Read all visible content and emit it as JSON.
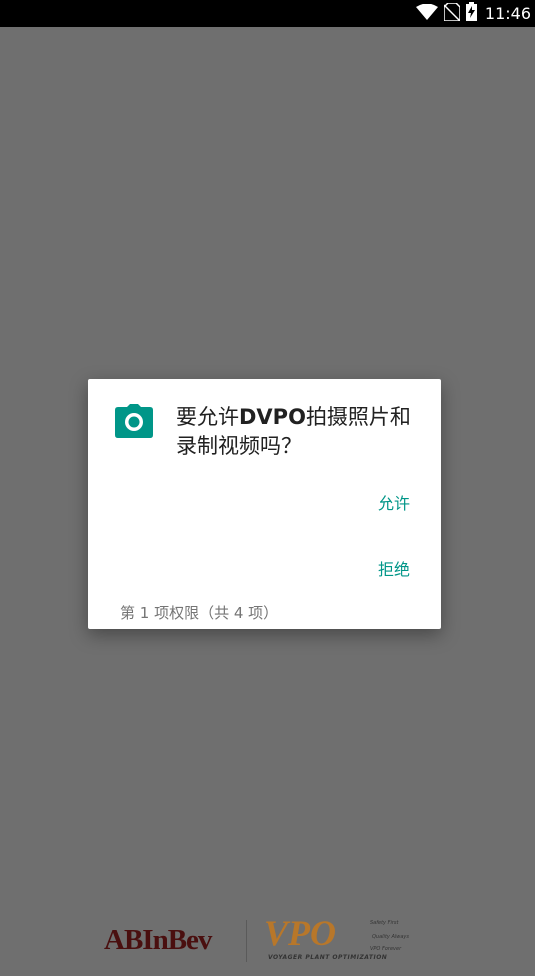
{
  "status_bar": {
    "time": "11:46",
    "icons": [
      "wifi-icon",
      "no-sim-icon",
      "battery-charging-icon"
    ]
  },
  "dialog": {
    "icon": "camera-icon",
    "title_prefix": "要允许",
    "app_name": "DVPO",
    "title_suffix": "拍摄照片和录制视频吗？",
    "allow_label": "允许",
    "deny_label": "拒绝",
    "permission_count": "第 1 项权限（共 4 项）",
    "accent_color": "#009688"
  },
  "footer": {
    "ab_logo": "ABInBev",
    "vpo_logo": "VPO",
    "vpo_subtitle": "VOYAGER PLANT OPTIMIZATION",
    "vpo_taglines": [
      "Safety First",
      "Quality Always",
      "VPO Forever"
    ]
  }
}
